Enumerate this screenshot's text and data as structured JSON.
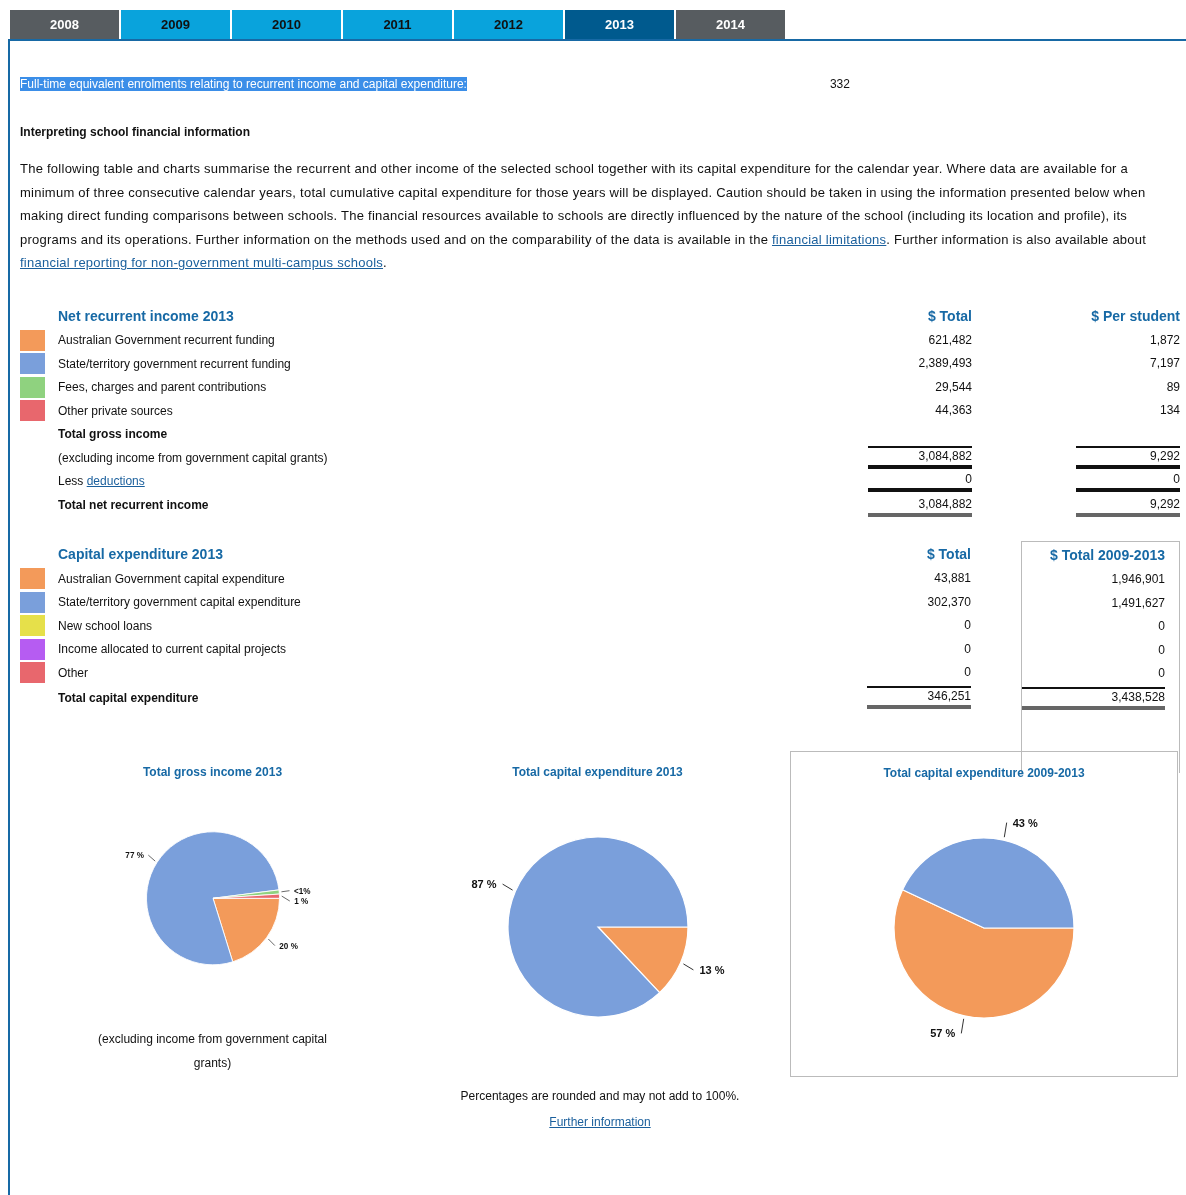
{
  "tabs": [
    {
      "label": "2008",
      "selected": false,
      "disabled": true
    },
    {
      "label": "2009",
      "selected": false,
      "disabled": false
    },
    {
      "label": "2010",
      "selected": false,
      "disabled": false
    },
    {
      "label": "2011",
      "selected": false,
      "disabled": false
    },
    {
      "label": "2012",
      "selected": false,
      "disabled": false
    },
    {
      "label": "2013",
      "selected": true,
      "disabled": false
    },
    {
      "label": "2014",
      "selected": false,
      "disabled": true
    }
  ],
  "enrolments": {
    "label": "Full-time equivalent enrolments relating to recurrent income and capital expenditure:",
    "highlighted": true,
    "value": "332"
  },
  "interpreting": {
    "title": "Interpreting school financial information",
    "paragraph": [
      {
        "kind": "text",
        "text": "The following table and charts summarise the recurrent and other income of the selected school together with its capital expenditure for the calendar year. Where data are available for a minimum of three consecutive calendar years, total cumulative capital expenditure for those years will be displayed. Caution should be taken in using the information presented below when making direct funding comparisons between schools. The financial resources available to schools are directly influenced by the nature of the school (including its location and profile), its programs and its operations. Further information on the methods used and on the comparability of the data is available in the "
      },
      {
        "kind": "link",
        "text": "financial limitations"
      },
      {
        "kind": "text",
        "text": ". Further information is also available about "
      },
      {
        "kind": "link",
        "text": "financial reporting for non-government multi-campus schools"
      },
      {
        "kind": "text",
        "text": "."
      }
    ]
  },
  "income": {
    "title": "Net recurrent income 2013",
    "columns": [
      "$ Total",
      "$ Per student"
    ],
    "boxed_column": false,
    "rows": [
      {
        "kind": "item",
        "label": "Australian Government recurrent funding",
        "color": "#f39a5a",
        "values": [
          "621,482",
          "1,872"
        ]
      },
      {
        "kind": "item",
        "label": "State/territory government recurrent funding",
        "color": "#7a9fdb",
        "values": [
          "2,389,493",
          "7,197"
        ]
      },
      {
        "kind": "item",
        "label": "Fees, charges and parent contributions",
        "color": "#8fd27f",
        "values": [
          "29,544",
          "89"
        ]
      },
      {
        "kind": "item",
        "label": "Other private sources",
        "color": "#e8676d",
        "values": [
          "44,363",
          "134"
        ]
      },
      {
        "kind": "heading",
        "label": "Total gross income"
      },
      {
        "kind": "subtotal",
        "label": "(excluding income from government capital grants)",
        "values": [
          "3,084,882",
          "9,292"
        ]
      },
      {
        "kind": "less",
        "label": "Less",
        "link": "deductions",
        "values": [
          "0",
          "0"
        ]
      },
      {
        "kind": "total",
        "label": "Total net recurrent income",
        "values": [
          "3,084,882",
          "9,292"
        ]
      }
    ]
  },
  "capital": {
    "title": "Capital expenditure 2013",
    "columns": [
      "$ Total",
      "$ Total 2009-2013"
    ],
    "boxed_column": true,
    "rows": [
      {
        "kind": "item",
        "label": "Australian Government capital expenditure",
        "color": "#f39a5a",
        "values": [
          "43,881",
          "1,946,901"
        ]
      },
      {
        "kind": "item",
        "label": "State/territory government capital expenditure",
        "color": "#7a9fdb",
        "values": [
          "302,370",
          "1,491,627"
        ]
      },
      {
        "kind": "item",
        "label": "New school loans",
        "color": "#e6e04a",
        "values": [
          "0",
          "0"
        ]
      },
      {
        "kind": "item",
        "label": "Income allocated to current capital projects",
        "color": "#b65cf2",
        "values": [
          "0",
          "0"
        ]
      },
      {
        "kind": "item",
        "label": "Other",
        "color": "#e8676d",
        "values": [
          "0",
          "0"
        ]
      },
      {
        "kind": "grand",
        "label": "Total capital expenditure",
        "values": [
          "346,251",
          "3,438,528"
        ]
      }
    ]
  },
  "charts": [
    {
      "boxed": false,
      "note": "(excluding income from government capital grants)",
      "chart_data": {
        "type": "pie",
        "title": "Total gross income 2013",
        "values": [
          20,
          77,
          1,
          1
        ],
        "value_labels": [
          "20 %",
          "77 %",
          "<1%",
          "1 %"
        ]
      }
    },
    {
      "boxed": false,
      "chart_data": {
        "type": "pie",
        "title": "Total capital expenditure 2013",
        "values": [
          13,
          87,
          0,
          0,
          0
        ],
        "value_labels": [
          "13 %",
          "87 %",
          null,
          null,
          null
        ]
      }
    },
    {
      "boxed": true,
      "chart_data": {
        "type": "pie",
        "title": "Total capital expenditure 2009-2013",
        "values": [
          57,
          43,
          0,
          0,
          0
        ],
        "value_labels": [
          "57 %",
          "43 %",
          null,
          null,
          null
        ]
      }
    }
  ],
  "footnote": "Percentages are rounded and may not add to 100%.",
  "further_link": "Further information"
}
